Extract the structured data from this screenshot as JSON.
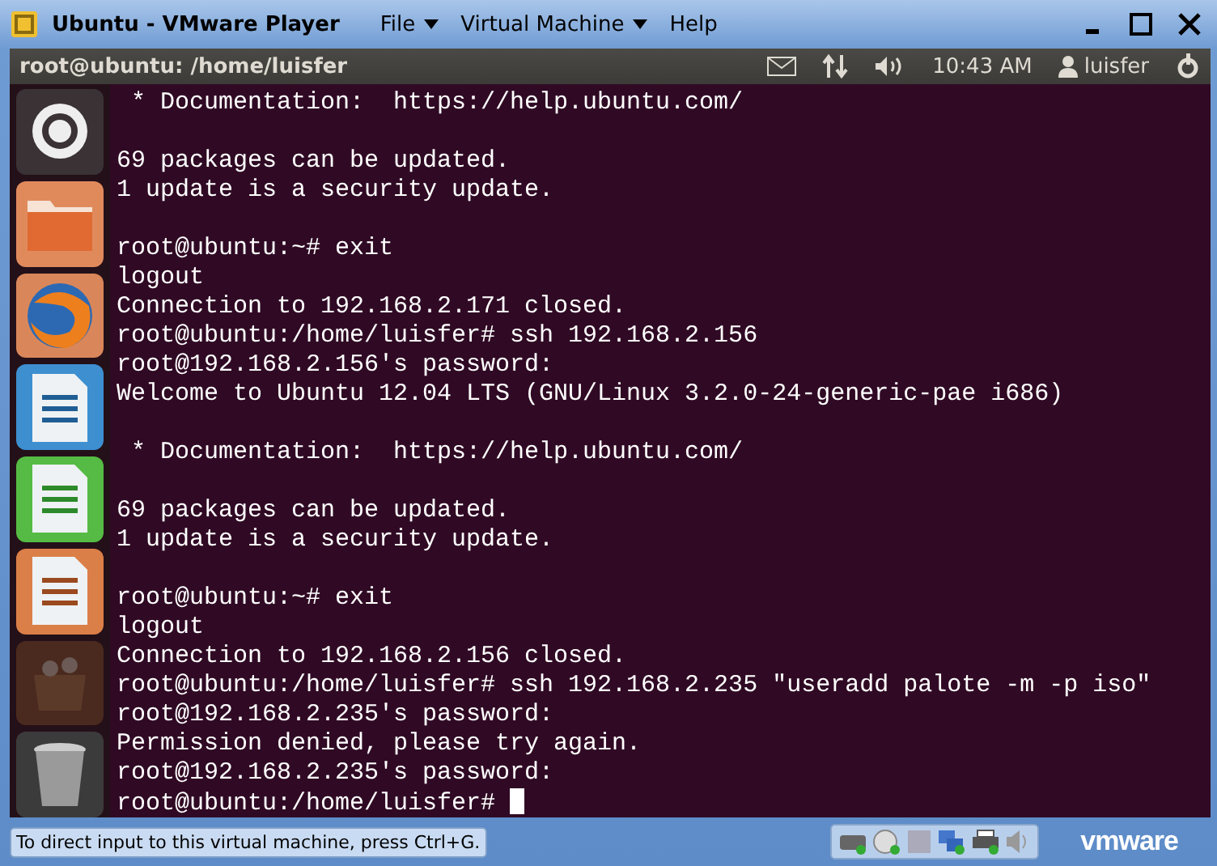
{
  "window": {
    "title": "Ubuntu - VMware Player",
    "menus": [
      "File",
      "Virtual Machine",
      "Help"
    ]
  },
  "panel": {
    "title": "root@ubuntu: /home/luisfer",
    "clock": "10:43 AM",
    "user": "luisfer"
  },
  "launcher": [
    {
      "kind": "dash"
    },
    {
      "kind": "files"
    },
    {
      "kind": "browser"
    },
    {
      "kind": "writer"
    },
    {
      "kind": "calc"
    },
    {
      "kind": "impress"
    },
    {
      "kind": "software"
    },
    {
      "kind": "trash"
    }
  ],
  "terminal": {
    "blocks": [
      [
        " * Documentation:  https://help.ubuntu.com/"
      ],
      [
        "69 packages can be updated.",
        "1 update is a security update."
      ],
      [
        "root@ubuntu:~# exit",
        "logout",
        "Connection to 192.168.2.171 closed.",
        "root@ubuntu:/home/luisfer# ssh 192.168.2.156",
        "root@192.168.2.156's password:",
        "Welcome to Ubuntu 12.04 LTS (GNU/Linux 3.2.0-24-generic-pae i686)"
      ],
      [
        " * Documentation:  https://help.ubuntu.com/"
      ],
      [
        "69 packages can be updated.",
        "1 update is a security update."
      ],
      [
        "root@ubuntu:~# exit",
        "logout",
        "Connection to 192.168.2.156 closed.",
        "root@ubuntu:/home/luisfer# ssh 192.168.2.235 \"useradd palote -m -p iso\"",
        "root@192.168.2.235's password:",
        "Permission denied, please try again.",
        "root@192.168.2.235's password:",
        "root@ubuntu:/home/luisfer# "
      ]
    ]
  },
  "status_bar": {
    "hint": "To direct input to this virtual machine, press Ctrl+G.",
    "logo": "vmware"
  }
}
